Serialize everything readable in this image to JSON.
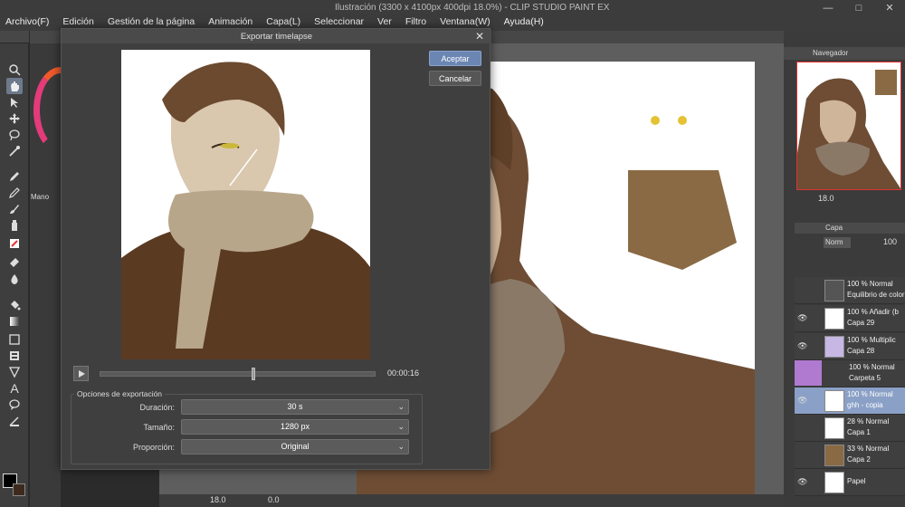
{
  "app": {
    "title": "Ilustración (3300 x 4100px 400dpi 18.0%) - CLIP STUDIO PAINT EX",
    "menu": [
      "Archivo(F)",
      "Edición",
      "Gestión de la página",
      "Animación",
      "Capa(L)",
      "Seleccionar",
      "Ver",
      "Filtro",
      "Ventana(W)",
      "Ayuda(H)"
    ],
    "window_controls": [
      "—",
      "□",
      "✕"
    ]
  },
  "tools": {
    "items": [
      "zoom-icon",
      "hand-icon",
      "operation-icon",
      "move-icon",
      "lasso-icon",
      "eyedropper-icon",
      "pen-icon",
      "pencil-icon",
      "brush-icon",
      "airbrush-icon",
      "decoration-icon",
      "eraser-icon",
      "blend-icon",
      "fill-icon",
      "gradient-icon",
      "figure-icon",
      "frame-icon",
      "ruler-icon",
      "text-icon",
      "balloon-icon",
      "correct-line-icon"
    ],
    "sub_label": "Mano",
    "colors": {
      "fg": "#000000",
      "bg": "#3d2a1c"
    }
  },
  "canvas": {
    "zoom": "18.0",
    "angle": "0.0"
  },
  "navigator": {
    "label": "Navegador",
    "zoom": "18.0"
  },
  "layers": {
    "tab_label": "Capa",
    "blend": "Norm",
    "opacity": "100",
    "items": [
      {
        "line1": "100 % Normal",
        "line2": "Equilibrio de color 1",
        "selected": false
      },
      {
        "line1": "100 % Añadir (b",
        "line2": "Capa 29",
        "selected": false
      },
      {
        "line1": "100 % Multiplic",
        "line2": "Capa 28",
        "selected": false
      },
      {
        "line1": "100 % Normal",
        "line2": "Carpeta 5",
        "selected": false
      },
      {
        "line1": "100 % Normal",
        "line2": "ghh - copia",
        "selected": true
      },
      {
        "line1": "28 % Normal",
        "line2": "Capa 1",
        "selected": false
      },
      {
        "line1": "33 % Normal",
        "line2": "Capa 2",
        "selected": false
      },
      {
        "line1": "",
        "line2": "Papel",
        "selected": false
      }
    ]
  },
  "dialog": {
    "title": "Exportar timelapse",
    "accept_label": "Aceptar",
    "cancel_label": "Cancelar",
    "playback_time": "00:00:16",
    "playback_progress": 0.55,
    "options_legend": "Opciones de exportación",
    "options": [
      {
        "label": "Duración:",
        "value": "30 s"
      },
      {
        "label": "Tamaño:",
        "value": "1280 px"
      },
      {
        "label": "Proporción:",
        "value": "Original"
      }
    ]
  }
}
